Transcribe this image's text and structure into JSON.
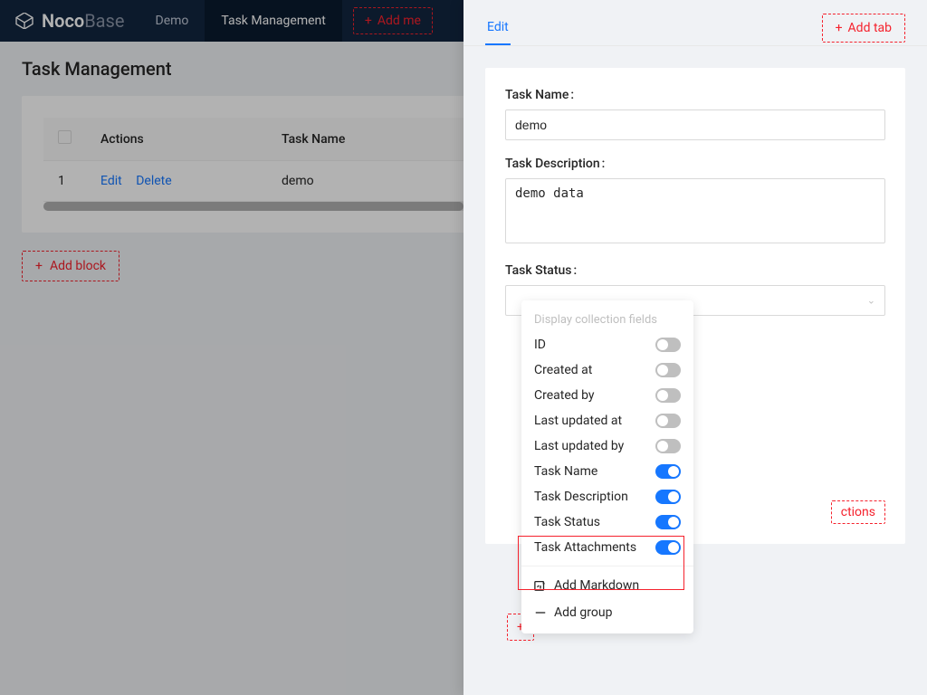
{
  "brand": {
    "bold": "Noco",
    "light": "Base"
  },
  "nav": {
    "demo": "Demo",
    "task_mgmt": "Task Management",
    "add_menu": "Add me"
  },
  "page": {
    "title": "Task Management"
  },
  "table": {
    "headers": {
      "actions": "Actions",
      "task_name": "Task Name"
    },
    "rows": [
      {
        "num": "1",
        "edit": "Edit",
        "delete": "Delete",
        "name": "demo"
      }
    ]
  },
  "add_block": "Add block",
  "drawer": {
    "tabs": {
      "edit": "Edit"
    },
    "add_tab": "Add tab",
    "form": {
      "task_name_label": "Task Name",
      "task_name_value": "demo",
      "task_desc_label": "Task Description",
      "task_desc_value": "demo data",
      "task_status_label": "Task Status"
    },
    "enable_actions": "ctions"
  },
  "dropdown": {
    "title": "Display collection fields",
    "items": [
      {
        "label": "ID",
        "on": false
      },
      {
        "label": "Created at",
        "on": false
      },
      {
        "label": "Created by",
        "on": false
      },
      {
        "label": "Last updated at",
        "on": false
      },
      {
        "label": "Last updated by",
        "on": false
      },
      {
        "label": "Task Name",
        "on": true
      },
      {
        "label": "Task Description",
        "on": true
      },
      {
        "label": "Task Status",
        "on": true
      },
      {
        "label": "Task Attachments",
        "on": true
      }
    ],
    "add_markdown": "Add Markdown",
    "add_group": "Add group"
  },
  "plus": "+"
}
